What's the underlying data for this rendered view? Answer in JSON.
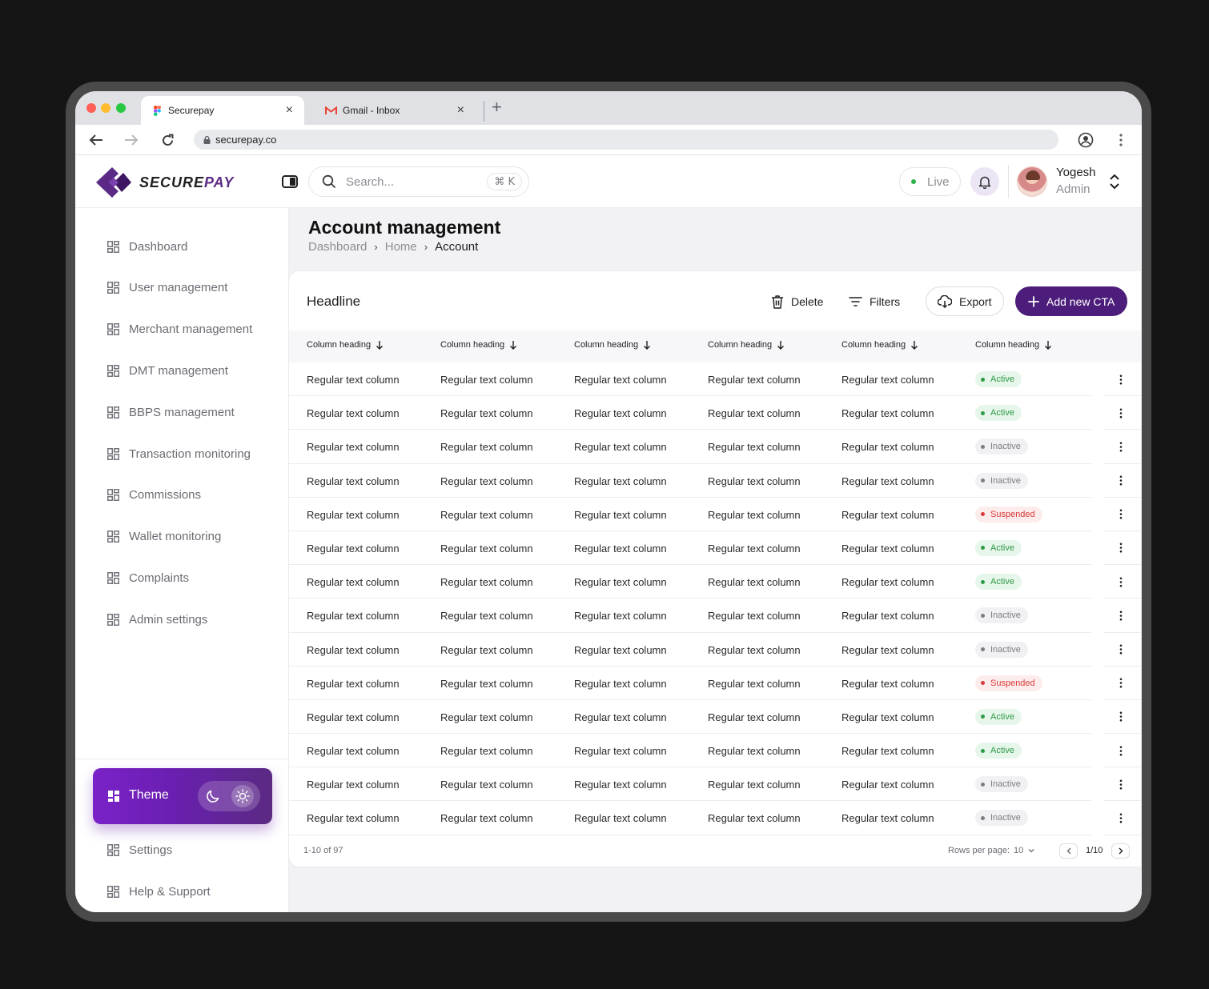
{
  "browser": {
    "tabs": [
      {
        "label": "Securepay",
        "active": true
      },
      {
        "label": "Gmail - Inbox",
        "active": false
      }
    ],
    "url": "securepay.co"
  },
  "brand": {
    "logo_left": "SECURE",
    "logo_right": "PAY",
    "accent": "#4c1d7a",
    "accent_light": "#7a22c9"
  },
  "header": {
    "search_placeholder": "Search...",
    "search_shortcut": "⌘ K",
    "live_label": "Live",
    "user_name": "Yogesh",
    "user_role": "Admin"
  },
  "sidebar": {
    "items": [
      {
        "label": "Dashboard",
        "icon": "grid-icon"
      },
      {
        "label": "User management",
        "icon": "grid-icon"
      },
      {
        "label": "Merchant management",
        "icon": "grid-icon"
      },
      {
        "label": "DMT management",
        "icon": "grid-icon"
      },
      {
        "label": "BBPS management",
        "icon": "grid-icon"
      },
      {
        "label": "Transaction monitoring",
        "icon": "grid-icon"
      },
      {
        "label": "Commissions",
        "icon": "grid-icon"
      },
      {
        "label": "Wallet monitoring",
        "icon": "grid-icon"
      },
      {
        "label": "Complaints",
        "icon": "grid-icon"
      },
      {
        "label": "Admin settings",
        "icon": "grid-icon"
      }
    ],
    "theme_label": "Theme",
    "bottom_items": [
      {
        "label": "Settings",
        "icon": "grid-icon"
      },
      {
        "label": "Help & Support",
        "icon": "grid-icon"
      }
    ]
  },
  "page": {
    "title": "Account management",
    "breadcrumb": [
      "Dashboard",
      "Home",
      "Account"
    ]
  },
  "table": {
    "headline": "Headline",
    "actions": {
      "delete": "Delete",
      "filters": "Filters",
      "export": "Export",
      "add": "Add new CTA"
    },
    "columns": [
      "Column heading",
      "Column heading",
      "Column heading",
      "Column heading",
      "Column heading",
      "Column heading"
    ],
    "cell_text": "Regular text column",
    "statuses": [
      "Active",
      "Active",
      "Inactive",
      "Inactive",
      "Suspended",
      "Active",
      "Active",
      "Inactive",
      "Inactive",
      "Suspended",
      "Active",
      "Active",
      "Inactive",
      "Inactive"
    ],
    "footer": {
      "range": "1-10 of 97",
      "rows_per_page_label": "Rows per page:",
      "rows_per_page_value": "10",
      "page": "1/10"
    }
  }
}
